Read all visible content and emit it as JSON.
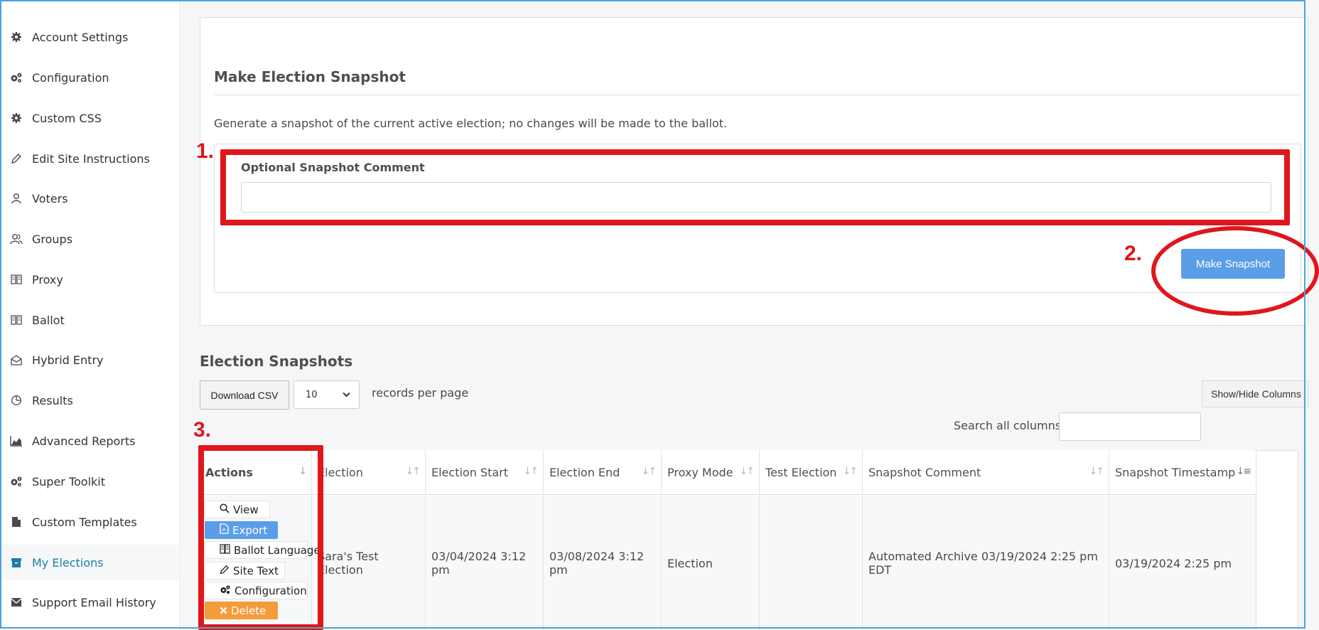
{
  "sidebar": {
    "items": [
      {
        "label": "Account Settings",
        "icon": "gear-icon",
        "active": false
      },
      {
        "label": "Configuration",
        "icon": "gears-icon",
        "active": false
      },
      {
        "label": "Custom CSS",
        "icon": "gear-icon",
        "active": false
      },
      {
        "label": "Edit Site Instructions",
        "icon": "pencil-icon",
        "active": false
      },
      {
        "label": "Voters",
        "icon": "user-icon",
        "active": false
      },
      {
        "label": "Groups",
        "icon": "users-icon",
        "active": false
      },
      {
        "label": "Proxy",
        "icon": "book-icon",
        "active": false
      },
      {
        "label": "Ballot",
        "icon": "book-icon",
        "active": false
      },
      {
        "label": "Hybrid Entry",
        "icon": "envelope-open-icon",
        "active": false
      },
      {
        "label": "Results",
        "icon": "pie-chart-icon",
        "active": false
      },
      {
        "label": "Advanced Reports",
        "icon": "area-chart-icon",
        "active": false
      },
      {
        "label": "Super Toolkit",
        "icon": "gears-icon",
        "active": false
      },
      {
        "label": "Custom Templates",
        "icon": "file-icon",
        "active": false
      },
      {
        "label": "My Elections",
        "icon": "archive-icon",
        "active": true
      },
      {
        "label": "Support Email History",
        "icon": "envelope-icon",
        "active": false
      }
    ]
  },
  "snapshot_panel": {
    "title": "Make Election Snapshot",
    "description": "Generate a snapshot of the current active election; no changes will be made to the ballot.",
    "comment_label": "Optional Snapshot Comment",
    "comment_value": "",
    "submit_label": "Make Snapshot"
  },
  "snapshots": {
    "title": "Election Snapshots",
    "download_csv_label": "Download CSV",
    "page_size": "10",
    "records_per_page_label": "records per page",
    "show_hide_label": "Show/Hide Columns",
    "search_label": "Search all columns:",
    "search_value": "",
    "columns": [
      "Actions",
      "Election",
      "Election Start",
      "Election End",
      "Proxy Mode",
      "Test Election",
      "Snapshot Comment",
      "Snapshot Timestamp"
    ],
    "row_actions": [
      {
        "label": "View",
        "icon": "search-icon"
      },
      {
        "label": "Export",
        "icon": "pdf-icon"
      },
      {
        "label": "Ballot Language",
        "icon": "book-icon"
      },
      {
        "label": "Site Text",
        "icon": "pencil-icon"
      },
      {
        "label": "Configuration",
        "icon": "gears-icon"
      },
      {
        "label": "Delete",
        "icon": "close-icon"
      }
    ],
    "rows": [
      {
        "election": "Sara's Test Election",
        "start": "03/04/2024 3:12 pm",
        "end": "03/08/2024 3:12 pm",
        "proxy_mode": "Election",
        "test_election": "",
        "comment": "Automated Archive 03/19/2024 2:25 pm EDT",
        "timestamp": "03/19/2024 2:25 pm"
      }
    ]
  },
  "annotations": {
    "color": "#e0161d",
    "labels": [
      "1.",
      "2.",
      "3."
    ]
  },
  "colors": {
    "primary": "#5b9ee8",
    "danger": "#f59b3a",
    "active_nav": "#1b7fa6"
  }
}
